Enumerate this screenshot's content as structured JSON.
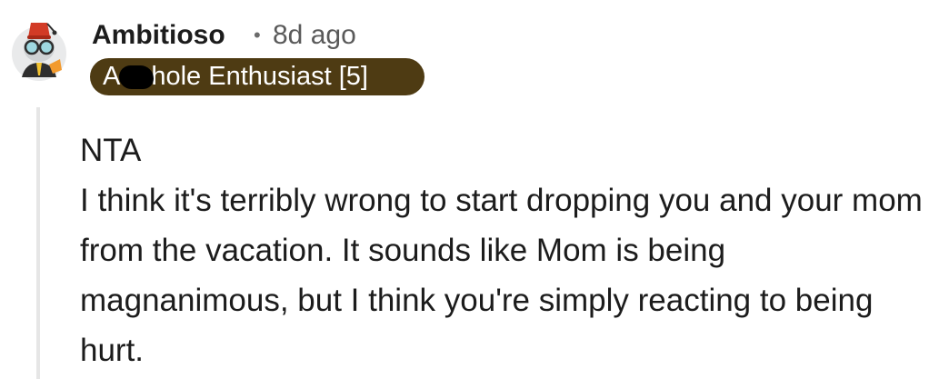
{
  "comment": {
    "author": "Ambitioso",
    "separator": "•",
    "timestamp": "8d ago",
    "avatar_icon": "fez-hat-avatar-icon",
    "flair": {
      "text": "A hole Enthusiast [5]",
      "prefix": "A",
      "suffix": "hole Enthusiast [5]",
      "background": "#4e3b13",
      "text_color": "#ffffff"
    },
    "body": {
      "lines": [
        "NTA",
        "I think it's terribly wrong to start dropping you and your mom from the vacation. It sounds like Mom is being magnanimous, but I think you're simply reacting to being hurt."
      ]
    }
  }
}
